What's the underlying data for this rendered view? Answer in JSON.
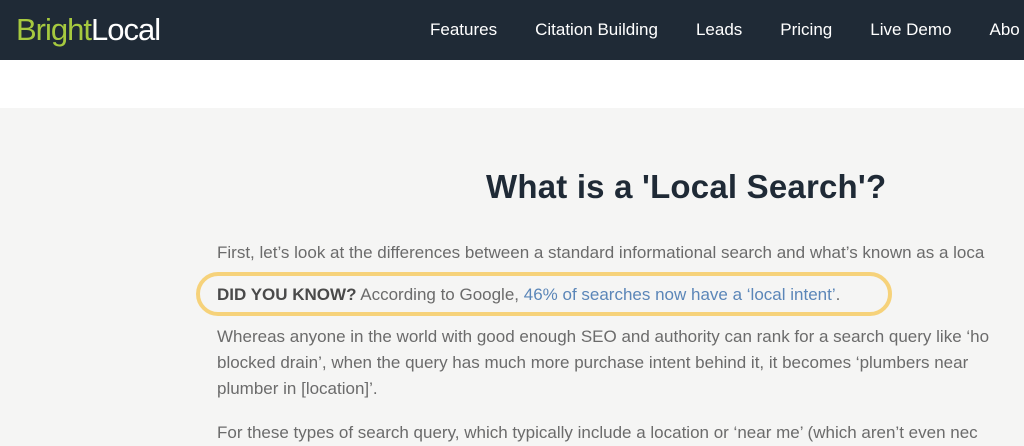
{
  "header": {
    "logo_bright": "Bright",
    "logo_local": "Local",
    "nav": [
      "Features",
      "Citation Building",
      "Leads",
      "Pricing",
      "Live Demo",
      "Abo"
    ]
  },
  "article": {
    "title": "What is a 'Local Search'?",
    "intro": "First, let’s look at the differences between a standard informational search and what’s known as a loca",
    "callout": {
      "label": "DID YOU KNOW?",
      "text": " According to Google, ",
      "link": "46% of searches now have a ‘local intent’",
      "end": "."
    },
    "para2_line1": "Whereas anyone in the world with good enough SEO and authority can rank for a search query like ‘ho",
    "para2_line2": "blocked drain’, when the query has much more purchase intent behind it, it becomes ‘plumbers near",
    "para2_line3": "plumber in [location]’.",
    "para3": "For these types of search query, which typically include a location or ‘near me’ (which aren’t even nec"
  },
  "colors": {
    "header_bg": "#1f2a36",
    "logo_green": "#a6c93f",
    "callout_border": "#f6d27a",
    "link": "#5b86b8"
  }
}
